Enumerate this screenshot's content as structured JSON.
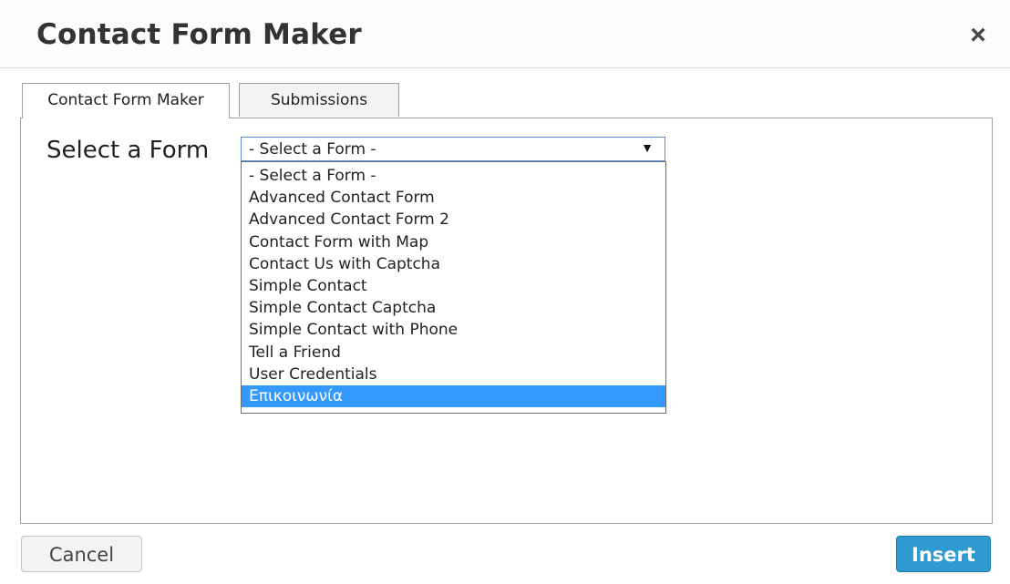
{
  "dialog": {
    "title": "Contact Form Maker",
    "close_label": "×"
  },
  "tabs": [
    {
      "label": "Contact Form Maker",
      "active": true
    },
    {
      "label": "Submissions",
      "active": false
    }
  ],
  "form": {
    "label": "Select a Form",
    "selected_value": "- Select a Form -",
    "options": [
      "- Select a Form -",
      "Advanced Contact Form",
      "Advanced Contact Form 2",
      "Contact Form with Map",
      "Contact Us with Captcha",
      "Simple Contact",
      "Simple Contact Captcha",
      "Simple Contact with Phone",
      "Tell a Friend",
      "User Credentials",
      "Επικοινωνία"
    ],
    "highlighted_option": "Επικοινωνία"
  },
  "buttons": {
    "cancel_label": "Cancel",
    "insert_label": "Insert"
  },
  "colors": {
    "accent": "#2e9ad1",
    "highlight": "#3399ff"
  },
  "icons": {
    "close": "close-icon",
    "dropdown": "chevron-down-icon"
  }
}
